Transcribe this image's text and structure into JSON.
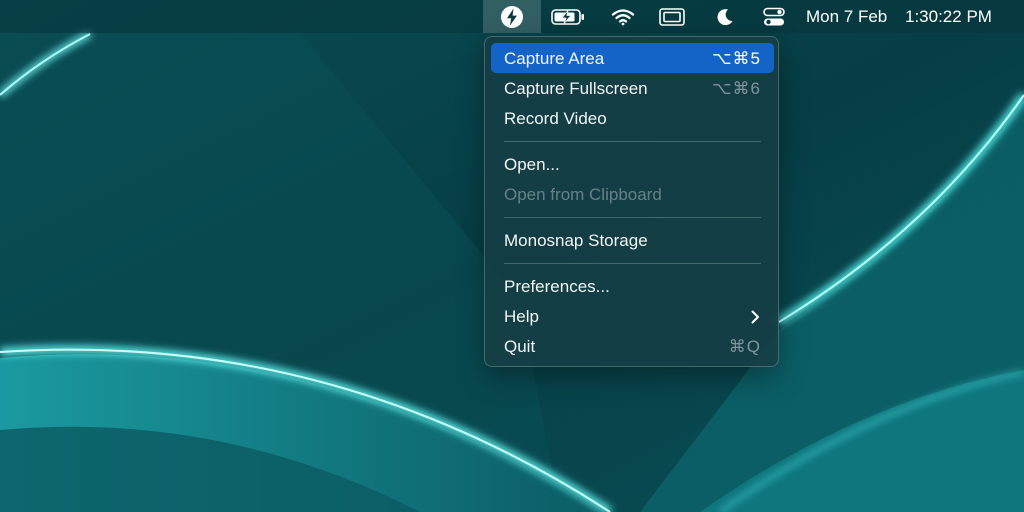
{
  "menubar": {
    "app_icon": "monosnap-bolt-icon",
    "status_icons": [
      "battery-charging-icon",
      "wifi-icon",
      "display-mirroring-icon",
      "moon-icon",
      "control-center-icon"
    ],
    "date": "Mon 7 Feb",
    "time": "1:30:22 PM"
  },
  "menu": {
    "groups": [
      [
        {
          "label": "Capture Area",
          "shortcut": "⌥⌘5",
          "state": "highlighted"
        },
        {
          "label": "Capture Fullscreen",
          "shortcut": "⌥⌘6",
          "state": "normal"
        },
        {
          "label": "Record Video",
          "shortcut": "",
          "state": "normal"
        }
      ],
      [
        {
          "label": "Open...",
          "shortcut": "",
          "state": "normal"
        },
        {
          "label": "Open from Clipboard",
          "shortcut": "",
          "state": "disabled"
        }
      ],
      [
        {
          "label": "Monosnap Storage",
          "shortcut": "",
          "state": "normal"
        }
      ],
      [
        {
          "label": "Preferences...",
          "shortcut": "",
          "state": "normal"
        },
        {
          "label": "Help",
          "shortcut": "",
          "state": "normal",
          "submenu": true
        },
        {
          "label": "Quit",
          "shortcut": "⌘Q",
          "state": "normal"
        }
      ]
    ]
  },
  "colors": {
    "highlight": "#1464c8",
    "wallpaper_base": "#0b4a50",
    "wallpaper_glow": "#3ff0ec"
  }
}
